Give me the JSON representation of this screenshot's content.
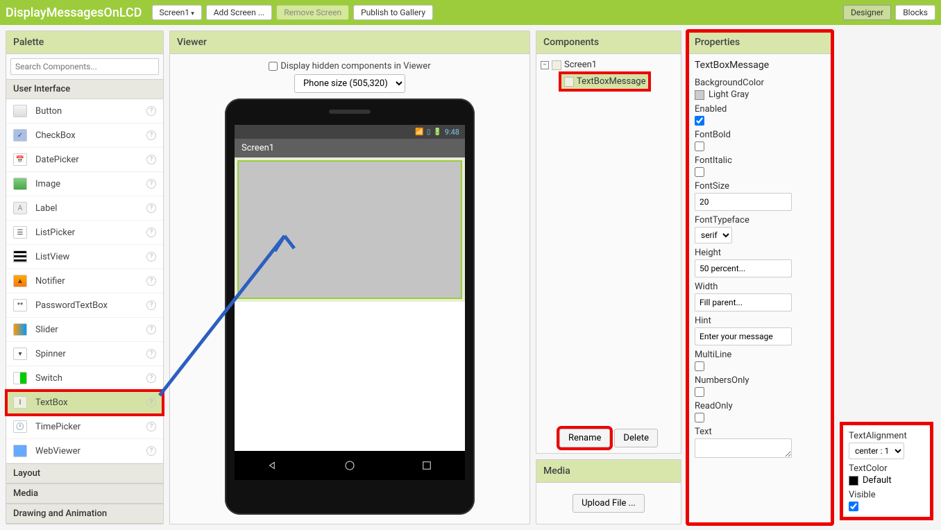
{
  "topbar": {
    "project_title": "DisplayMessagesOnLCD",
    "screen_btn": "Screen1",
    "add_screen": "Add Screen ...",
    "remove_screen": "Remove Screen",
    "publish": "Publish to Gallery",
    "designer": "Designer",
    "blocks": "Blocks"
  },
  "palette": {
    "title": "Palette",
    "search_placeholder": "Search Components...",
    "cat_ui": "User Interface",
    "items": [
      "Button",
      "CheckBox",
      "DatePicker",
      "Image",
      "Label",
      "ListPicker",
      "ListView",
      "Notifier",
      "PasswordTextBox",
      "Slider",
      "Spinner",
      "Switch",
      "TextBox",
      "TimePicker",
      "WebViewer"
    ],
    "cat_layout": "Layout",
    "cat_media": "Media",
    "cat_drawing": "Drawing and Animation"
  },
  "viewer": {
    "title": "Viewer",
    "hidden_label": "Display hidden components in Viewer",
    "size_label": "Phone size (505,320)",
    "status_time": "9:48",
    "screen_name": "Screen1"
  },
  "components": {
    "title": "Components",
    "root": "Screen1",
    "child": "TextBoxMessage",
    "rename": "Rename",
    "delete": "Delete"
  },
  "media": {
    "title": "Media",
    "upload": "Upload File ..."
  },
  "properties": {
    "title": "Properties",
    "selected": "TextBoxMessage",
    "bgcolor_label": "BackgroundColor",
    "bgcolor_value": "Light Gray",
    "enabled_label": "Enabled",
    "fontbold_label": "FontBold",
    "fontitalic_label": "FontItalic",
    "fontsize_label": "FontSize",
    "fontsize_value": "20",
    "fonttypeface_label": "FontTypeface",
    "fonttypeface_value": "serif",
    "height_label": "Height",
    "height_value": "50 percent...",
    "width_label": "Width",
    "width_value": "Fill parent...",
    "hint_label": "Hint",
    "hint_value": "Enter your message",
    "multiline_label": "MultiLine",
    "numbersonly_label": "NumbersOnly",
    "readonly_label": "ReadOnly",
    "text_label": "Text",
    "textalign_label": "TextAlignment",
    "textalign_value": "center : 1",
    "textcolor_label": "TextColor",
    "textcolor_value": "Default",
    "visible_label": "Visible"
  }
}
